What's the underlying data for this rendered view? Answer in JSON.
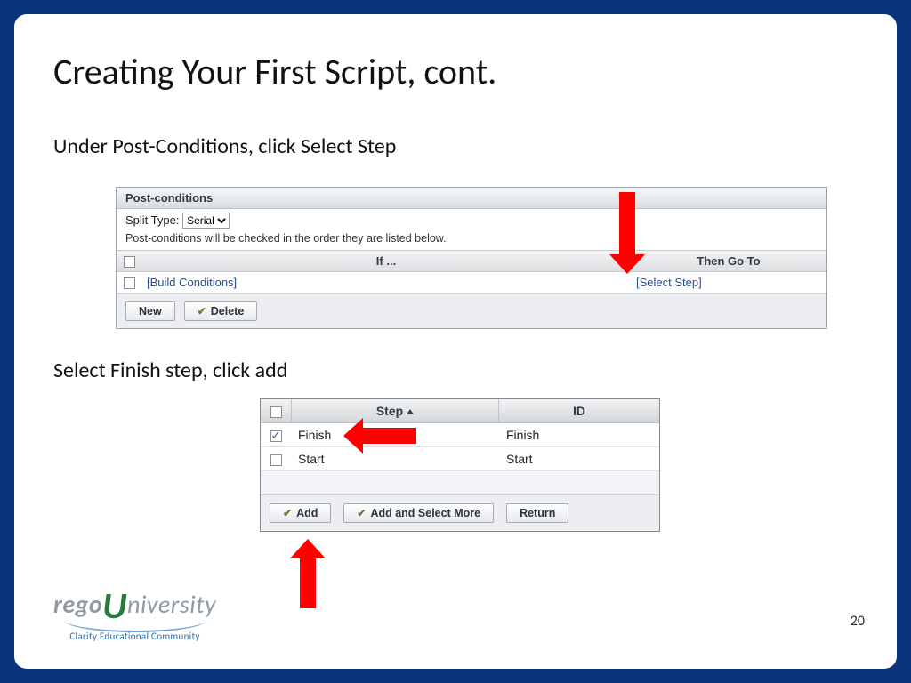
{
  "slide": {
    "title": "Creating Your First Script, cont.",
    "instruction1": "Under Post-Conditions, click Select Step",
    "instruction2": "Select Finish step, click add",
    "page_number": "20"
  },
  "panel1": {
    "header": "Post-conditions",
    "split_type_label": "Split Type:",
    "split_type_value": "Serial",
    "note": "Post-conditions will be checked in the order they are listed below.",
    "col_if": "If ...",
    "col_then": "Then Go To",
    "row": {
      "if_link": "[Build Conditions]",
      "then_link": "[Select Step]"
    },
    "buttons": {
      "new": "New",
      "delete": "Delete"
    }
  },
  "panel2": {
    "col_step": "Step",
    "col_id": "ID",
    "rows": [
      {
        "checked": true,
        "step": "Finish",
        "id": "Finish"
      },
      {
        "checked": false,
        "step": "Start",
        "id": "Start"
      }
    ],
    "buttons": {
      "add": "Add",
      "add_more": "Add and Select More",
      "return": "Return"
    }
  },
  "logo": {
    "part1": "rego",
    "part2": "U",
    "part3": "niversity",
    "tagline": "Clarity Educational Community"
  }
}
